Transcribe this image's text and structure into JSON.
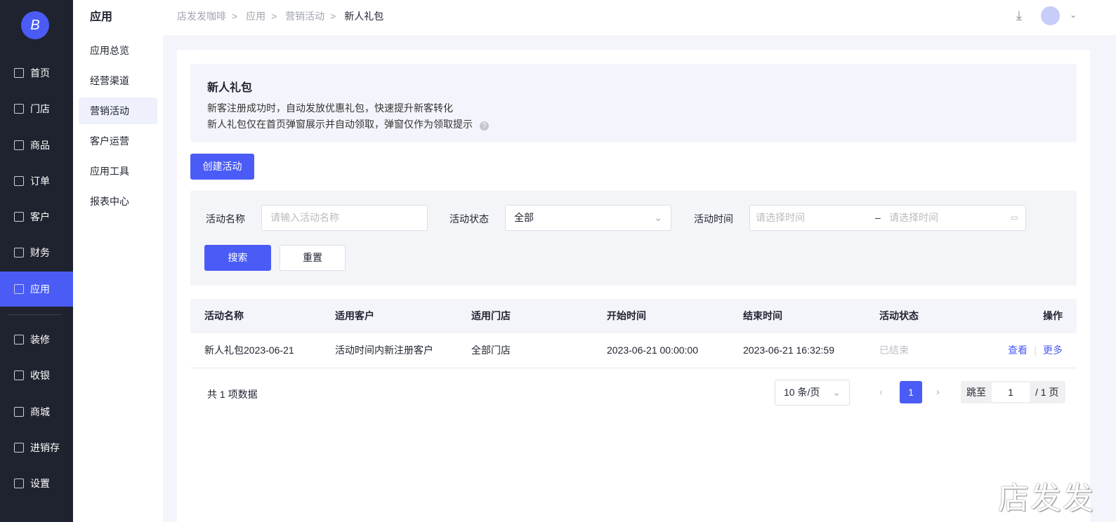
{
  "sidebar": {
    "logo": "B",
    "items": [
      {
        "label": "首页",
        "icon": "home-icon"
      },
      {
        "label": "门店",
        "icon": "store-icon"
      },
      {
        "label": "商品",
        "icon": "bag-icon"
      },
      {
        "label": "订单",
        "icon": "order-icon"
      },
      {
        "label": "客户",
        "icon": "user-icon"
      },
      {
        "label": "财务",
        "icon": "wallet-icon"
      },
      {
        "label": "应用",
        "icon": "apps-icon"
      },
      {
        "label": "装修",
        "icon": "layers-icon"
      },
      {
        "label": "收银",
        "icon": "cashier-icon"
      },
      {
        "label": "商城",
        "icon": "mall-icon"
      },
      {
        "label": "进销存",
        "icon": "inventory-icon"
      },
      {
        "label": "设置",
        "icon": "settings-icon"
      }
    ]
  },
  "subnav": {
    "title": "应用",
    "items": [
      "应用总览",
      "经营渠道",
      "营销活动",
      "客户运营",
      "应用工具",
      "报表中心"
    ]
  },
  "breadcrumb": [
    "店发发咖啡",
    "应用",
    "营销活动",
    "新人礼包"
  ],
  "intro": {
    "title": "新人礼包",
    "line1": "新客注册成功时，自动发放优惠礼包，快速提升新客转化",
    "line2": "新人礼包仅在首页弹窗展示并自动领取，弹窗仅作为领取提示",
    "help": "?"
  },
  "create_label": "创建活动",
  "filter": {
    "name_label": "活动名称",
    "name_placeholder": "请输入活动名称",
    "status_label": "活动状态",
    "status_value": "全部",
    "time_label": "活动时间",
    "start_placeholder": "请选择时间",
    "dash": "–",
    "end_placeholder": "请选择时间",
    "search": "搜索",
    "reset": "重置"
  },
  "table": {
    "headers": [
      "活动名称",
      "适用客户",
      "适用门店",
      "开始时间",
      "结束时间",
      "活动状态",
      "操作"
    ],
    "rows": [
      {
        "name": "新人礼包2023-06-21",
        "customer": "活动时间内新注册客户",
        "store": "全部门店",
        "start": "2023-06-21 00:00:00",
        "end": "2023-06-21 16:32:59",
        "status": "已结束",
        "view": "查看",
        "more": "更多"
      }
    ]
  },
  "pagination": {
    "total": "共 1 项数据",
    "page_size": "10 条/页",
    "current": "1",
    "jump_label": "跳至",
    "jump_value": "1",
    "total_pages": "/ 1 页"
  },
  "watermark": "店发发"
}
